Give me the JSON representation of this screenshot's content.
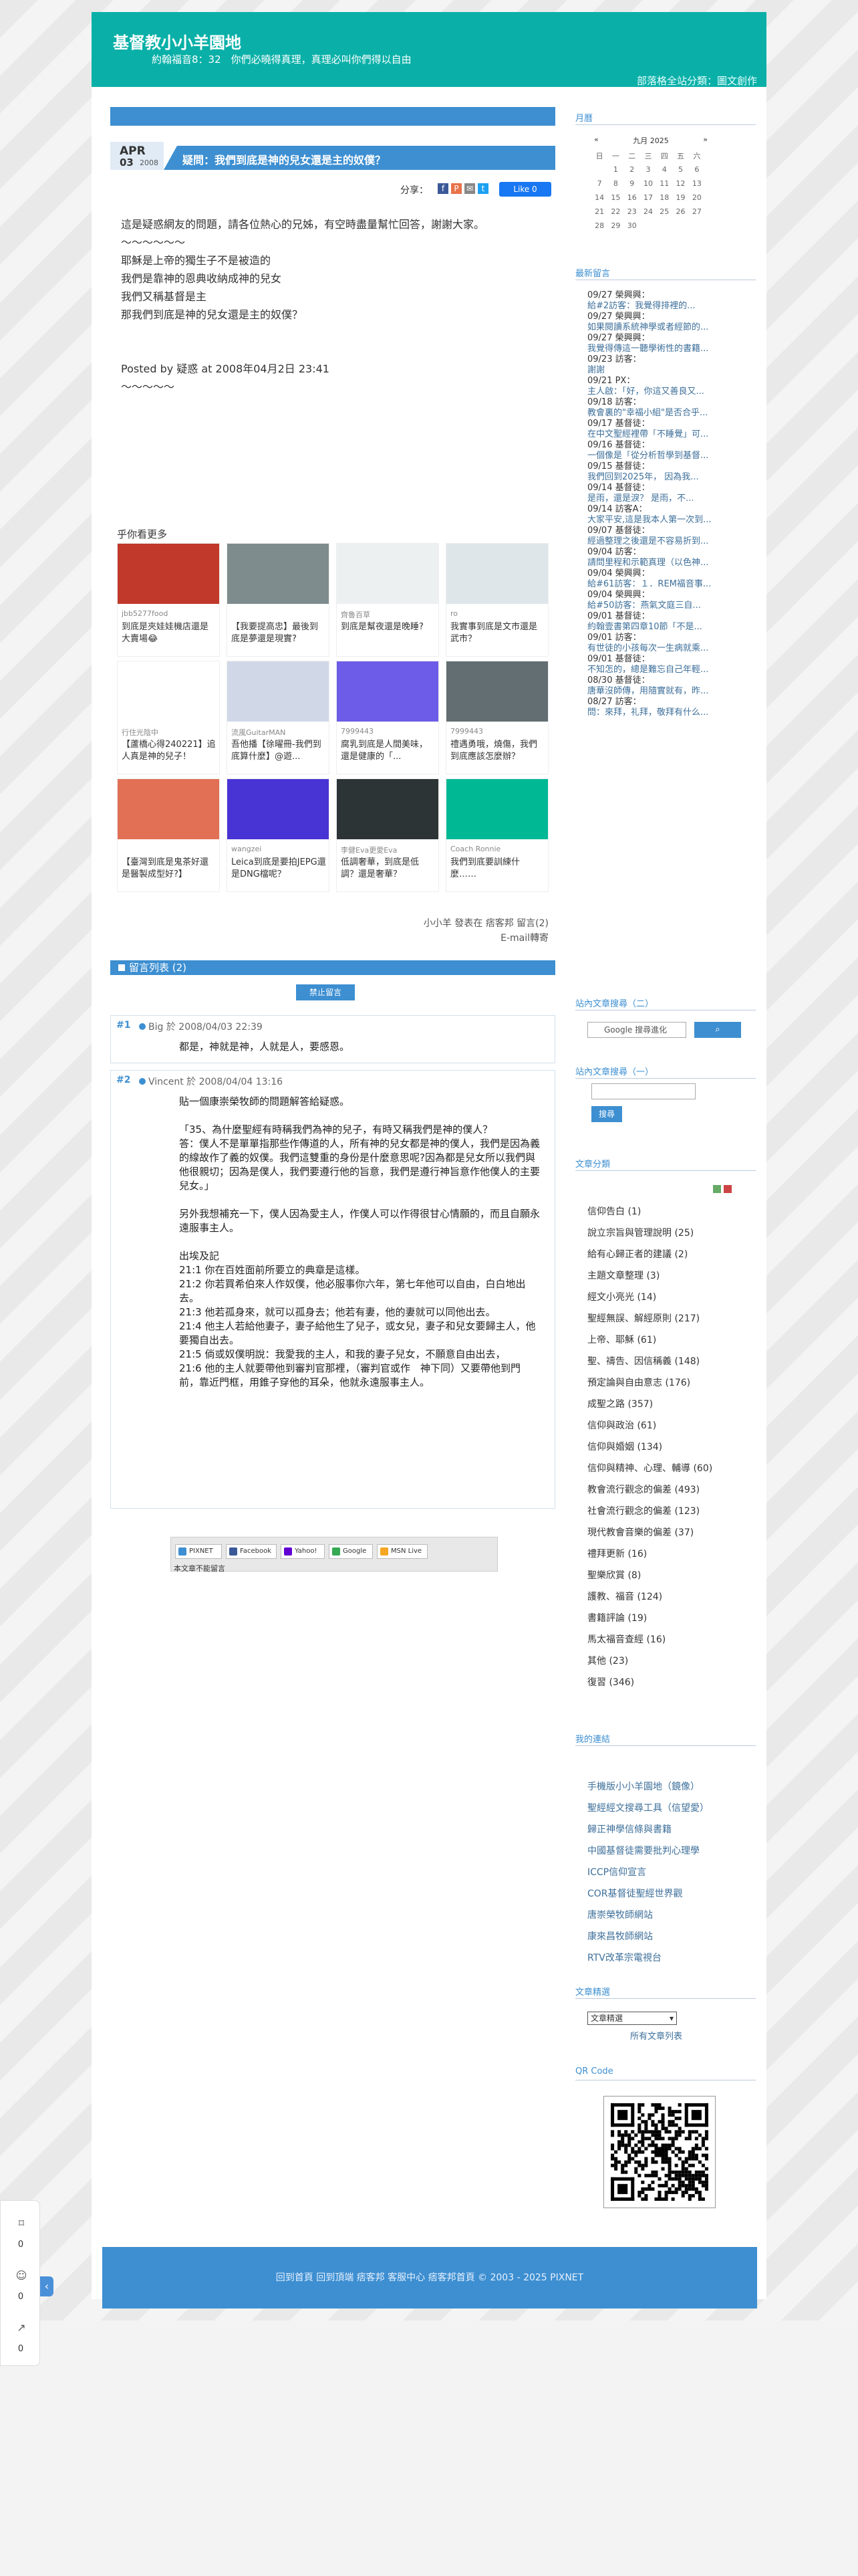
{
  "site": {
    "title": "基督教小小羊園地",
    "subtitle": "約翰福音8：32　你們必曉得真理，真理必叫你們得以自由",
    "header_link": "部落格全站分類：圖文創作",
    "copyright": "© 2003 - 2025 PIXNET",
    "footer_links": "回到首頁 回到頂端 痞客邦 客服中心 痞客邦首頁"
  },
  "post": {
    "month": "APR",
    "day": "03",
    "year": "2008",
    "title": "疑問：我們到底是神的兒女還是主的奴僕？",
    "share_label": "分享：",
    "like_label": "Like 0",
    "body": "這是疑惑網友的問題，請各位熱心的兄姊，有空時盡量幫忙回答，謝謝大家。\n～～～～～～\n耶穌是上帝的獨生子不是被造的\n我們是靠神的恩典收納成神的兒女\n我們又稱基督是主\n那我們到底是神的兒女還是主的奴僕？",
    "posted_by": "Posted by 疑惑 at 2008年04月2日 23:41",
    "tilde": "～～～～～"
  },
  "related": {
    "title": "乎你看更多",
    "cards": [
      {
        "meta": "jbb5277food",
        "title": "到底是夾娃娃機店還是大賣場😂"
      },
      {
        "meta": "",
        "title": "【我要提高忠】最後到底是夢還是現實?"
      },
      {
        "meta": "齊魯百草",
        "title": "到底是幫夜還是晚睡?"
      },
      {
        "meta": "ro",
        "title": "我實事到底是文市還是武市？"
      },
      {
        "meta": "行住光陰中",
        "title": "【蘆橋心得240221】追人真是神的兒子！"
      },
      {
        "meta": "流風GuitarMAN",
        "title": "吾他播【徐曜冊-我們到底算什麼】@遊..."
      },
      {
        "meta": "7999443",
        "title": "腐乳到底是人間美味，還是健康的「..."
      },
      {
        "meta": "7999443",
        "title": "禮遇勇哦，燒傷，我們到底應該怎麼辦？"
      },
      {
        "meta": "",
        "title": "【臺灣到底是鬼茶好還是醫製成型好?】"
      },
      {
        "meta": "wangzei",
        "title": "Leica到底是要拍JEPG還是DNG檔呢？"
      },
      {
        "meta": "李健Eva更愛Eva",
        "title": "低調奢華，到底是低調？還是奢華？"
      },
      {
        "meta": "Coach Ronnie",
        "title": "我們到底要訓練什麼……"
      }
    ]
  },
  "footnote": {
    "line1": "小小羊 發表在 痞客邦 留言(2)",
    "line2": "E-mail轉寄"
  },
  "comments": {
    "header": "留言列表 (2)",
    "leave_label": "禁止留言",
    "items": [
      {
        "num": "#1",
        "who": "Big 於 2008/04/03 22:39",
        "text": "都是，神就是神，人就是人，要感恩。"
      },
      {
        "num": "#2",
        "who": "Vincent 於 2008/04/04 13:16",
        "text": "貼一個康崇榮牧師的問題解答給疑惑。\n\n「35、為什麼聖經有時稱我們為神的兒子，有時又稱我們是神的僕人？\n答：僕人不是單單指那些作傳道的人，所有神的兒女都是神的僕人，我們是因為義的線故作了義的奴僕。我們這雙重的身份是什麼意思呢?因為都是兒女所以我們與他很親切；因為是僕人，我們要遵行他的旨意，我們是遵行神旨意作他僕人的主要兒女。」\n\n另外我想補充一下，僕人因為愛主人，作僕人可以作得很甘心情願的，而且自願永遠服事主人。\n\n出埃及記\n21:1 你在百姓面前所要立的典章是這樣。\n21:2 你若買希伯來人作奴僕，他必服事你六年，第七年他可以自由，白白地出去。\n21:3 他若孤身來，就可以孤身去；他若有妻，他的妻就可以同他出去。\n21:4 他主人若給他妻子，妻子給他生了兒子，或女兒，妻子和兒女要歸主人，他要獨自出去。\n21:5 倘或奴僕明說：我愛我的主人，和我的妻子兒女，不願意自由出去，\n21:6 他的主人就要帶他到審判官那裡，（審判官或作　神下同）又要帶他到門前，靠近門框，用錐子穿他的耳朵，他就永遠服事主人。"
      }
    ]
  },
  "bookmarks": {
    "items": [
      "PIXNET",
      "Facebook",
      "Yahoo!",
      "Google",
      "MSN Live"
    ],
    "note": "本文章不能留言"
  },
  "sidebar": {
    "calendar_title": "月曆",
    "calendar_month": "九月 2025",
    "weekdays": [
      "日",
      "一",
      "二",
      "三",
      "四",
      "五",
      "六"
    ],
    "weeks": [
      [
        "",
        "1",
        "2",
        "3",
        "4",
        "5",
        "6"
      ],
      [
        "7",
        "8",
        "9",
        "10",
        "11",
        "12",
        "13"
      ],
      [
        "14",
        "15",
        "16",
        "17",
        "18",
        "19",
        "20"
      ],
      [
        "21",
        "22",
        "23",
        "24",
        "25",
        "26",
        "27"
      ],
      [
        "28",
        "29",
        "30",
        "",
        "",
        "",
        ""
      ]
    ],
    "recent_title": "最新留言",
    "recent": [
      {
        "w": "09/27 榮興興：",
        "t": "給#2訪客：我覺得排裡的..."
      },
      {
        "w": "09/27 榮興興：",
        "t": "如果閱讀系統神學或者經節的..."
      },
      {
        "w": "09/27 榮興興：",
        "t": "我覺得傳這一聽學術性的書籍..."
      },
      {
        "w": "09/23 訪客：",
        "t": "謝謝"
      },
      {
        "w": "09/21 PX：",
        "t": "主人啟：「好，你這又善良又..."
      },
      {
        "w": "09/18 訪客：",
        "t": "教會裏的\"幸福小組\"是否合乎..."
      },
      {
        "w": "09/17 基督徒：",
        "t": "在中文聖經裡帶「不睡覺」可..."
      },
      {
        "w": "09/16 基督徒：",
        "t": "一個像是「從分析哲學到基督..."
      },
      {
        "w": "09/15 基督徒：",
        "t": "我們回到2025年， 因為我..."
      },
      {
        "w": "09/14 基督徒：",
        "t": "是雨，還是淚？ 是雨，不..."
      },
      {
        "w": "09/14 訪客A：",
        "t": "大家平安,這是我本人第一次到..."
      },
      {
        "w": "09/07 基督徒：",
        "t": "經過整理之後還是不容易折到..."
      },
      {
        "w": "09/04 訪客：",
        "t": "請問里程和示範真理（以色神..."
      },
      {
        "w": "09/04 榮興興：",
        "t": "給#61訪客：１．REM福音事..."
      },
      {
        "w": "09/04 榮興興：",
        "t": "給#50訪客：燕氣文庭三自..."
      },
      {
        "w": "09/01 基督徒：",
        "t": "約翰壹書第四章10節「不是..."
      },
      {
        "w": "09/01 訪客：",
        "t": "有世徒的小孩每次一生病就乘..."
      },
      {
        "w": "09/01 基督徒：",
        "t": "不知怎的，總是難忘自己年輕..."
      },
      {
        "w": "08/30 基督徒：",
        "t": "唐華沒師傳，用隨實就有，昨..."
      },
      {
        "w": "08/27 訪客：",
        "t": "問：來拜，礼拜，敬拜有什么..."
      }
    ],
    "gsearch_title": "站內文章搜尋（二）",
    "gsearch_placeholder": "Google  搜尋進化",
    "search_title": "站內文章搜尋（一）",
    "search_btn": "搜尋",
    "cats_title": "文章分類",
    "cats": [
      "信仰告白 (1)",
      "說立宗旨與管理說明 (25)",
      "給有心歸正者的建議 (2)",
      "主題文章整理 (3)",
      "經文小亮光 (14)",
      "聖經無誤、解經原則 (217)",
      "上帝、耶穌 (61)",
      "聖、禱告、因信稱義 (148)",
      "預定論與自由意志 (176)",
      "成聖之路 (357)",
      "信仰與政治 (61)",
      "信仰與婚姻 (134)",
      "信仰與精神、心理、輔導 (60)",
      "教會流行觀念的偏差 (493)",
      "社會流行觀念的偏差 (123)",
      "現代教會音樂的偏差 (37)",
      "禮拜更新 (16)",
      "聖樂欣賞 (8)",
      "護教、福音 (124)",
      "書籍評論 (19)",
      "馬太福音查經 (16)",
      "其他 (23)",
      "復習 (346)"
    ],
    "links_title": "我的連結",
    "links": [
      "手機版小小羊園地（鏡像）",
      "聖經經文搜尋工具（信望愛）",
      "歸正神學信條與書籍",
      "中國基督徒需要批判心理學",
      "ICCP信仰宣言",
      "COR基督徒聖經世界觀",
      "唐崇榮牧師網站",
      "康來昌牧師網站",
      "RTV改革宗電視台"
    ],
    "archive_title": "文章精選",
    "archive_select": "文章精選",
    "all_posts": "所有文章列表",
    "qr_title": "QR Code"
  },
  "floating": {
    "count1": "0",
    "count2": "0",
    "count3": "0"
  }
}
